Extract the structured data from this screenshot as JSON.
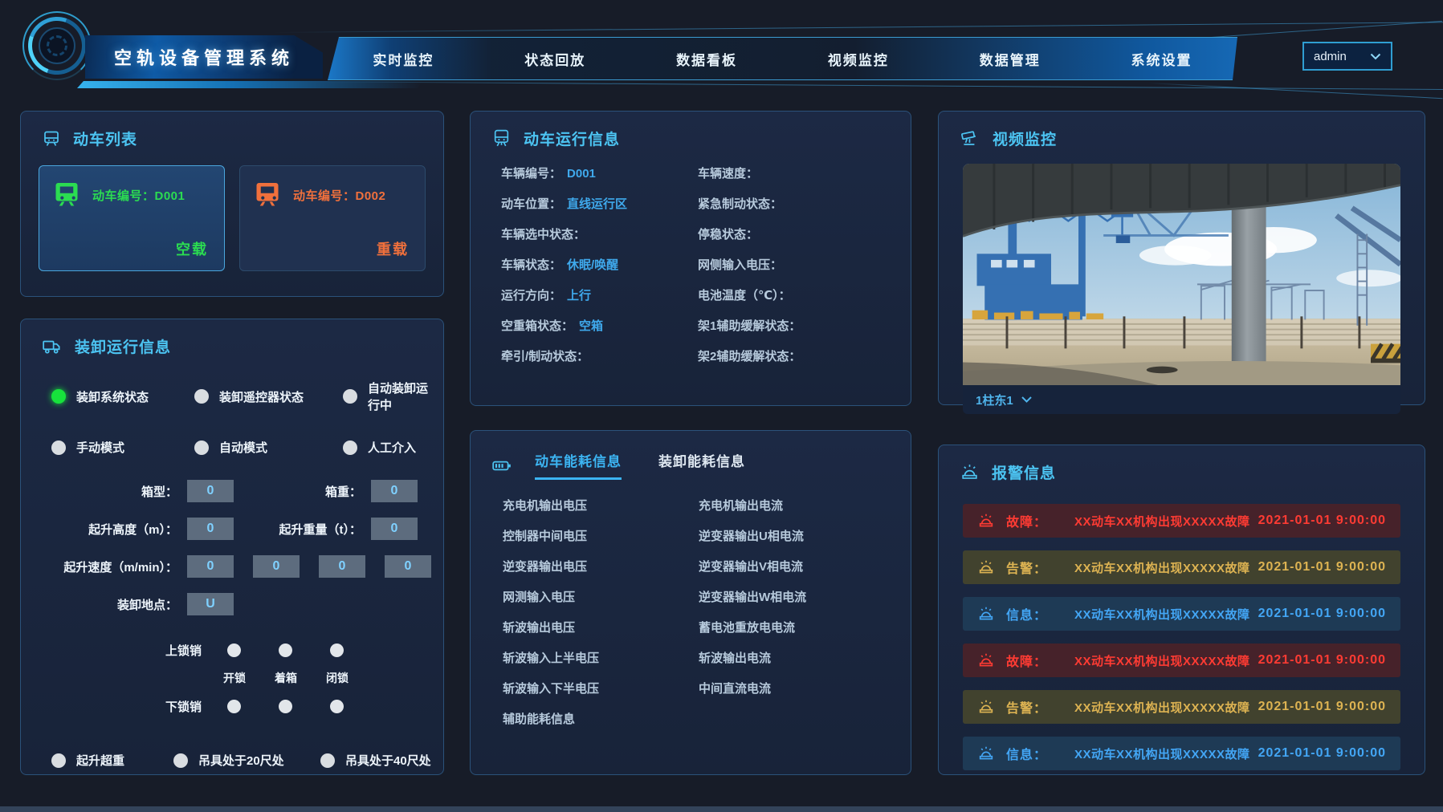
{
  "app": {
    "title": "空轨设备管理系统",
    "user": "admin"
  },
  "nav": {
    "items": [
      {
        "label": "实时监控"
      },
      {
        "label": "状态回放"
      },
      {
        "label": "数据看板"
      },
      {
        "label": "视频监控"
      },
      {
        "label": "数据管理"
      },
      {
        "label": "系统设置"
      }
    ]
  },
  "train_list": {
    "title": "动车列表",
    "cards": [
      {
        "id_label": "动车编号：D001",
        "status": "空载",
        "color": "#2bdc51",
        "selected": true
      },
      {
        "id_label": "动车编号：D002",
        "status": "重载",
        "color": "#f0703c",
        "selected": false
      }
    ]
  },
  "loading": {
    "title": "装卸运行信息",
    "indicators": [
      {
        "label": "装卸系统状态",
        "on": true
      },
      {
        "label": "装卸遥控器状态",
        "on": false
      },
      {
        "label": "自动装卸运行中",
        "on": false
      },
      {
        "label": "手动模式",
        "on": false
      },
      {
        "label": "自动模式",
        "on": false
      },
      {
        "label": "人工介入",
        "on": false
      }
    ],
    "fields": {
      "box_type": {
        "label": "箱型：",
        "value": "0"
      },
      "box_weight": {
        "label": "箱重：",
        "value": "0"
      },
      "lift_height": {
        "label": "起升高度（m）：",
        "value": "0"
      },
      "lift_weight": {
        "label": "起升重量（t）：",
        "value": "0"
      },
      "lift_speed": {
        "label": "起升速度（m/min）：",
        "values": [
          "0",
          "0",
          "0",
          "0"
        ]
      },
      "place": {
        "label": "装卸地点：",
        "value": "U"
      }
    },
    "locks": {
      "upper_label": "上锁销",
      "lower_label": "下锁销",
      "state_labels": [
        "开锁",
        "着箱",
        "闭锁"
      ]
    },
    "bottom_indicators": [
      {
        "label": "起升超重",
        "on": false
      },
      {
        "label": "吊具处于20尺处",
        "on": false
      },
      {
        "label": "吊具处于40尺处",
        "on": false
      }
    ]
  },
  "run_info": {
    "title": "动车运行信息",
    "left": [
      {
        "label": "车辆编号：",
        "value": "D001"
      },
      {
        "label": "动车位置：",
        "value": "直线运行区"
      },
      {
        "label": "车辆选中状态：",
        "value": ""
      },
      {
        "label": "车辆状态：",
        "value": "休眠/唤醒"
      },
      {
        "label": "运行方向：",
        "value": "上行"
      },
      {
        "label": "空重箱状态：",
        "value": "空箱"
      },
      {
        "label": "牵引/制动状态：",
        "value": ""
      }
    ],
    "right": [
      {
        "label": "车辆速度：",
        "value": ""
      },
      {
        "label": "紧急制动状态：",
        "value": ""
      },
      {
        "label": "停稳状态：",
        "value": ""
      },
      {
        "label": "网侧输入电压：",
        "value": ""
      },
      {
        "label": "电池温度（℃）：",
        "value": ""
      },
      {
        "label": "架1辅助缓解状态：",
        "value": ""
      },
      {
        "label": "架2辅助缓解状态：",
        "value": ""
      }
    ]
  },
  "energy": {
    "tabs": [
      {
        "label": "动车能耗信息",
        "active": true
      },
      {
        "label": "装卸能耗信息",
        "active": false
      }
    ],
    "left": [
      "充电机输出电压",
      "控制器中间电压",
      "逆变器输出电压",
      "网测输入电压",
      "斩波输出电压",
      "斩波输入上半电压",
      "斩波输入下半电压",
      "辅助能耗信息"
    ],
    "right": [
      "充电机输出电流",
      "逆变器输出U相电流",
      "逆变器输出V相电流",
      "逆变器输出W相电流",
      "蓄电池重放电电流",
      "斩波输出电流",
      "中间直流电流",
      ""
    ]
  },
  "video": {
    "title": "视频监控",
    "camera": "1柱东1"
  },
  "alarms": {
    "title": "报警信息",
    "rows": [
      {
        "type": "fault",
        "type_label": "故障：",
        "message": "XX动车XX机构出现XXXXX故障",
        "time": "2021-01-01 9:00:00"
      },
      {
        "type": "warn",
        "type_label": "告警：",
        "message": "XX动车XX机构出现XXXXX故障",
        "time": "2021-01-01 9:00:00"
      },
      {
        "type": "info",
        "type_label": "信息：",
        "message": "XX动车XX机构出现XXXXX故障",
        "time": "2021-01-01 9:00:00"
      },
      {
        "type": "fault",
        "type_label": "故障：",
        "message": "XX动车XX机构出现XXXXX故障",
        "time": "2021-01-01 9:00:00"
      },
      {
        "type": "warn",
        "type_label": "告警：",
        "message": "XX动车XX机构出现XXXXX故障",
        "time": "2021-01-01 9:00:00"
      },
      {
        "type": "info",
        "type_label": "信息：",
        "message": "XX动车XX机构出现XXXXX故障",
        "time": "2021-01-01 9:00:00"
      }
    ]
  },
  "colors": {
    "accent": "#4cc4f2",
    "green_on": "#17e23c",
    "card_green": "#2bdc51",
    "card_orange": "#f0703c",
    "fault": "#ff3b33",
    "fault_bg": "#46222a",
    "warn": "#ddb352",
    "warn_bg": "#41422e",
    "info": "#43a6f5",
    "info_bg": "#1e3a55",
    "panel_border": "#2b527a",
    "value_box_bg": "#5d6c7e"
  }
}
